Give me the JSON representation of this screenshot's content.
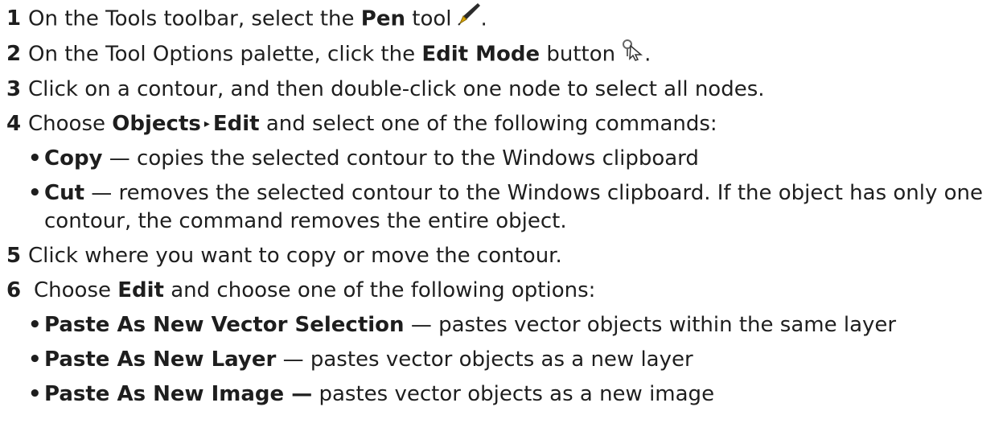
{
  "steps": [
    {
      "num": "1",
      "pre": "On the Tools toolbar, select the ",
      "bold": "Pen",
      "post": " tool",
      "icon": "pen-icon",
      "end": "."
    },
    {
      "num": "2",
      "pre": "On the Tool Options palette, click the ",
      "bold": "Edit Mode",
      "post": " button",
      "icon": "edit-mode-icon",
      "end": "."
    },
    {
      "num": "3",
      "text": "Click on a contour, and then double-click one node to select all nodes."
    },
    {
      "num": "4",
      "pre": "Choose ",
      "bold1": "Objects",
      "arrow": "▸",
      "bold2": "Edit",
      "post": " and select one of the following commands:",
      "bullets": [
        {
          "bold": "Copy",
          "text": " — copies the selected contour to the Windows clipboard"
        },
        {
          "bold": "Cut",
          "text": " — removes the selected contour to the Windows clipboard. If the object has only one contour, the command removes the entire object."
        }
      ]
    },
    {
      "num": "5",
      "text": "Click where you want to copy or move the contour."
    },
    {
      "num": "6",
      "pre": "Choose ",
      "bold": "Edit",
      "post": " and choose one of the following options:",
      "bullets": [
        {
          "bold": "Paste As New Vector Selection",
          "text": " — pastes vector objects within the same layer"
        },
        {
          "bold": "Paste As New Layer",
          "text": " — pastes vector objects as a new layer"
        },
        {
          "bold": "Paste As New Image —",
          "text": " pastes vector objects as a new image"
        }
      ]
    }
  ],
  "bullet_char": "•",
  "colors": {
    "text": "#1e1e1e",
    "pen_body": "#2b2b2b",
    "pen_tip": "#d9a400"
  }
}
